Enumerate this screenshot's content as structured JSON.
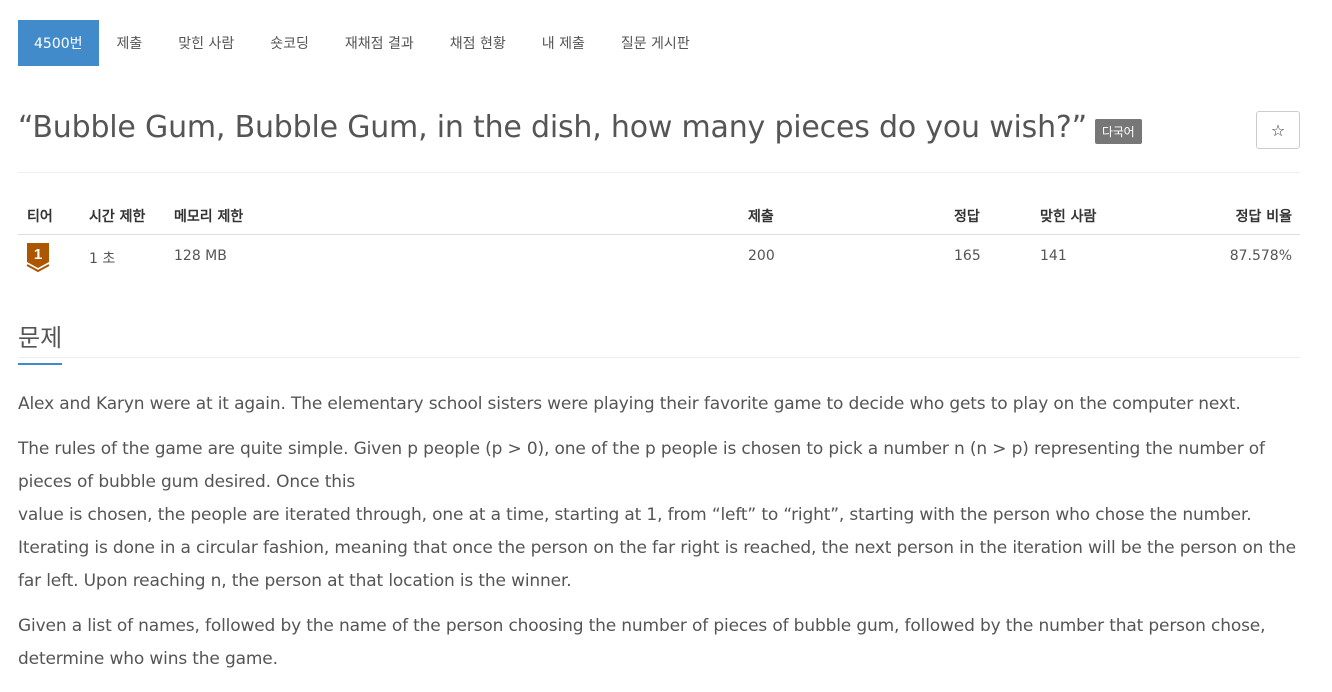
{
  "tabs": [
    {
      "label": "4500번"
    },
    {
      "label": "제출"
    },
    {
      "label": "맞힌 사람"
    },
    {
      "label": "숏코딩"
    },
    {
      "label": "재채점 결과"
    },
    {
      "label": "채점 현황"
    },
    {
      "label": "내 제출"
    },
    {
      "label": "질문 게시판"
    }
  ],
  "problem": {
    "title": "“Bubble Gum, Bubble Gum, in the dish, how many pieces do you wish?”",
    "lang_badge": "다국어",
    "star_icon": "☆"
  },
  "info_table": {
    "headers": {
      "tier": "티어",
      "time_limit": "시간 제한",
      "memory_limit": "메모리 제한",
      "submissions": "제출",
      "accepted": "정답",
      "solvers": "맞힌 사람",
      "ratio": "정답 비율"
    },
    "values": {
      "tier_number": "1",
      "time_limit": "1 초",
      "memory_limit": "128 MB",
      "submissions": "200",
      "accepted": "165",
      "solvers": "141",
      "ratio": "87.578%"
    },
    "tier_color": "#ad5600"
  },
  "section": {
    "title": "문제",
    "paragraphs": [
      "Alex and Karyn were at it again. The elementary school sisters were playing their favorite game to decide who gets to play on the computer next.",
      "The rules of the game are quite simple. Given p people (p > 0), one of the p people is chosen to pick a number n (n > p) representing the number of pieces of bubble gum desired. Once this",
      "value is chosen, the people are iterated through, one at a time, starting at 1, from “left” to “right”, starting with the person who chose the number. Iterating is done in a circular fashion, meaning that once the person on the far right is reached, the next person in the iteration will be the person on the far left. Upon reaching n, the person at that location is the winner.",
      "Given a list of names, followed by the name of the person choosing the number of pieces of bubble gum, followed by the number that person chose, determine who wins the game."
    ]
  },
  "colors": {
    "accent": "#428bca",
    "badge": "#777777"
  }
}
